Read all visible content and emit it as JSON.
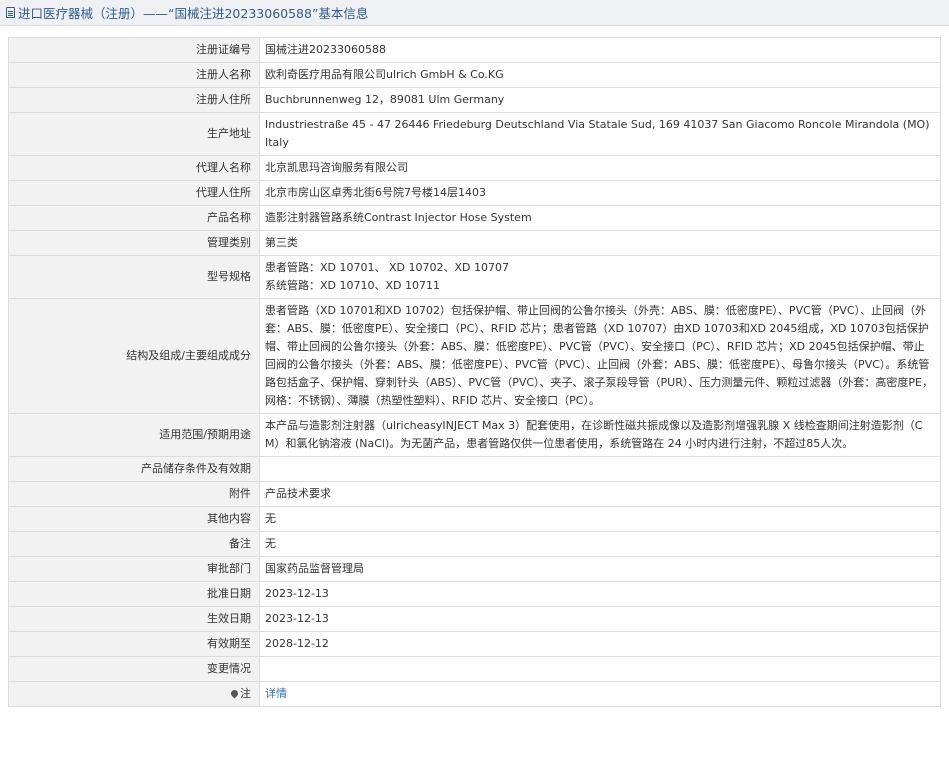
{
  "title": "进口医疗器械（注册）——“国械注进20233060588”基本信息",
  "rows": [
    {
      "label": "注册证编号",
      "lines": [
        "国械注进20233060588"
      ]
    },
    {
      "label": "注册人名称",
      "lines": [
        "欧利奇医疗用品有限公司ulrich GmbH & Co.KG"
      ]
    },
    {
      "label": "注册人住所",
      "lines": [
        "Buchbrunnenweg 12，89081 Ulm Germany"
      ]
    },
    {
      "label": "生产地址",
      "lines": [
        "Industriestraße 45 - 47 26446 Friedeburg Deutschland Via Statale Sud, 169 41037 San Giacomo Roncole Mirandola (MO) Italy"
      ]
    },
    {
      "label": "代理人名称",
      "lines": [
        "北京凯思玛咨询服务有限公司"
      ]
    },
    {
      "label": "代理人住所",
      "lines": [
        "北京市房山区卓秀北街6号院7号楼14层1403"
      ]
    },
    {
      "label": "产品名称",
      "lines": [
        "造影注射器管路系统Contrast Injector Hose System"
      ]
    },
    {
      "label": "管理类别",
      "lines": [
        "第三类"
      ]
    },
    {
      "label": "型号规格",
      "lines": [
        "患者管路：XD 10701、 XD 10702、XD 10707",
        "系统管路：XD 10710、XD 10711"
      ]
    },
    {
      "label": "结构及组成/主要组成成分",
      "lines": [
        "患者管路（XD 10701和XD 10702）包括保护帽、带止回阀的公鲁尔接头（外壳：ABS、膜：低密度PE）、PVC管（PVC）、止回阀（外套：ABS、膜：低密度PE）、安全接口（PC）、RFID 芯片；患者管路（XD 10707）由XD 10703和XD 2045组成，XD 10703包括保护帽、带止回阀的公鲁尔接头（外套：ABS、膜：低密度PE）、PVC管（PVC）、安全接口（PC）、RFID 芯片；XD 2045包括保护帽、带止回阀的公鲁尔接头（外套：ABS、膜：低密度PE）、PVC管（PVC）、止回阀（外套：ABS、膜：低密度PE）、母鲁尔接头（PVC）。系统管路包括盒子、保护帽、穿刺针头（ABS）、PVC管（PVC）、夹子、滚子泵段导管（PUR）、压力测量元件、颗粒过滤器（外套：高密度PE，网格：不锈钢）、薄膜（热塑性塑料）、RFID 芯片、安全接口（PC）。"
      ]
    },
    {
      "label": "适用范围/预期用途",
      "lines": [
        "本产品与造影剂注射器（ulricheasyINJECT Max 3）配套使用，在诊断性磁共振成像以及造影剂增强乳腺 X 线检查期间注射造影剂（CM）和氯化钠溶液 (NaCl)。为无菌产品，患者管路仅供一位患者使用，系统管路在 24 小时内进行注射，不超过85人次。"
      ]
    },
    {
      "label": "产品储存条件及有效期",
      "lines": [
        ""
      ]
    },
    {
      "label": "附件",
      "lines": [
        "产品技术要求"
      ]
    },
    {
      "label": "其他内容",
      "lines": [
        "无"
      ]
    },
    {
      "label": "备注",
      "lines": [
        "无"
      ]
    },
    {
      "label": "审批部门",
      "lines": [
        "国家药品监督管理局"
      ]
    },
    {
      "label": "批准日期",
      "lines": [
        "2023-12-13"
      ]
    },
    {
      "label": "生效日期",
      "lines": [
        "2023-12-13"
      ]
    },
    {
      "label": "有效期至",
      "lines": [
        "2028-12-12"
      ]
    },
    {
      "label": "变更情况",
      "lines": [
        ""
      ]
    }
  ],
  "note": {
    "label": "注",
    "link": "详情"
  }
}
